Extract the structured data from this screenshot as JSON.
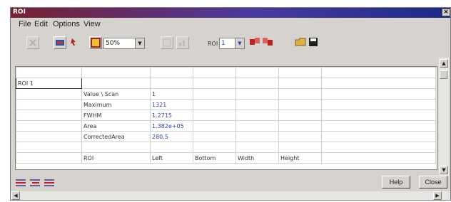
{
  "window": {
    "title": "ROI"
  },
  "menu": {
    "items": [
      "File",
      "Edit",
      "Options",
      "View"
    ]
  },
  "toolbar": {
    "zoom_value": "50%",
    "roi_label": "ROI",
    "roi_value": "1"
  },
  "table": {
    "name_cell": "ROI 1",
    "rows": [
      [
        "",
        "Value \\ Scan",
        "1",
        "",
        "",
        ""
      ],
      [
        "",
        "Maximum",
        "1321",
        "",
        "",
        ""
      ],
      [
        "",
        "FWHM",
        "1.2715",
        "",
        "",
        ""
      ],
      [
        "",
        "Area",
        "1.382e+05",
        "",
        "",
        ""
      ],
      [
        "",
        "CorrectedArea",
        "280.5",
        "",
        "",
        ""
      ],
      [
        "",
        "",
        "",
        "",
        "",
        ""
      ],
      [
        "",
        "ROI",
        "Left",
        "Bottom",
        "Width",
        "Height"
      ]
    ]
  },
  "buttons": {
    "help": "Help",
    "close": "Close"
  }
}
